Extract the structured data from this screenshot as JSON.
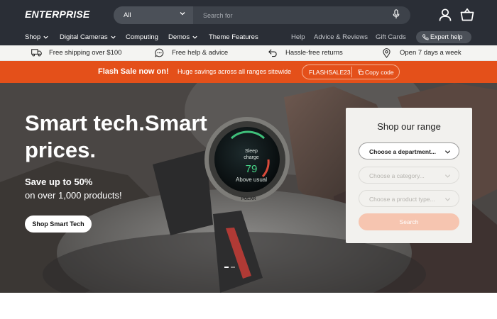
{
  "header": {
    "logo": "ENTERPRISE",
    "search": {
      "scope": "All",
      "placeholder": "Search for"
    },
    "icons": [
      "microphone-icon",
      "account-icon",
      "cart-icon"
    ]
  },
  "nav": {
    "left": [
      {
        "label": "Shop",
        "has_dropdown": true
      },
      {
        "label": "Digital Cameras",
        "has_dropdown": true
      },
      {
        "label": "Computing",
        "has_dropdown": false
      },
      {
        "label": "Demos",
        "has_dropdown": true
      },
      {
        "label": "Theme Features",
        "has_dropdown": false
      }
    ],
    "right": [
      {
        "label": "Help"
      },
      {
        "label": "Advice & Reviews"
      },
      {
        "label": "Gift Cards"
      }
    ],
    "expert_button": "Expert help"
  },
  "perks": [
    {
      "icon": "truck-icon",
      "label": "Free shipping over $100"
    },
    {
      "icon": "chat-icon",
      "label": "Free help & advice"
    },
    {
      "icon": "return-arrow-icon",
      "label": "Hassle-free returns"
    },
    {
      "icon": "location-pin-icon",
      "label": "Open 7 days a week"
    }
  ],
  "flash": {
    "title": "Flash Sale now on!",
    "subtitle": "Huge savings across all ranges sitewide",
    "code": "FLASHSALE23",
    "copy_label": "Copy code"
  },
  "hero": {
    "title": "Smart tech.Smart prices.",
    "subtitle_line1": "Save up to 50%",
    "subtitle_line2": "on over 1,000 products!",
    "button": "Shop Smart Tech",
    "watch_screen": {
      "line1": "Sleep",
      "line2": "charge",
      "value": "79",
      "status": "Above usual",
      "brand": "POLAR"
    },
    "slides": 2,
    "active_slide": 1
  },
  "range_panel": {
    "title": "Shop our range",
    "department_placeholder": "Choose a department...",
    "category_placeholder": "Choose a category...",
    "product_type_placeholder": "Choose a product type...",
    "search_button": "Search"
  },
  "colors": {
    "header_bg": "#2a2e36",
    "accent_orange": "#e4501a",
    "search_button_disabled": "#f6c5b0"
  }
}
